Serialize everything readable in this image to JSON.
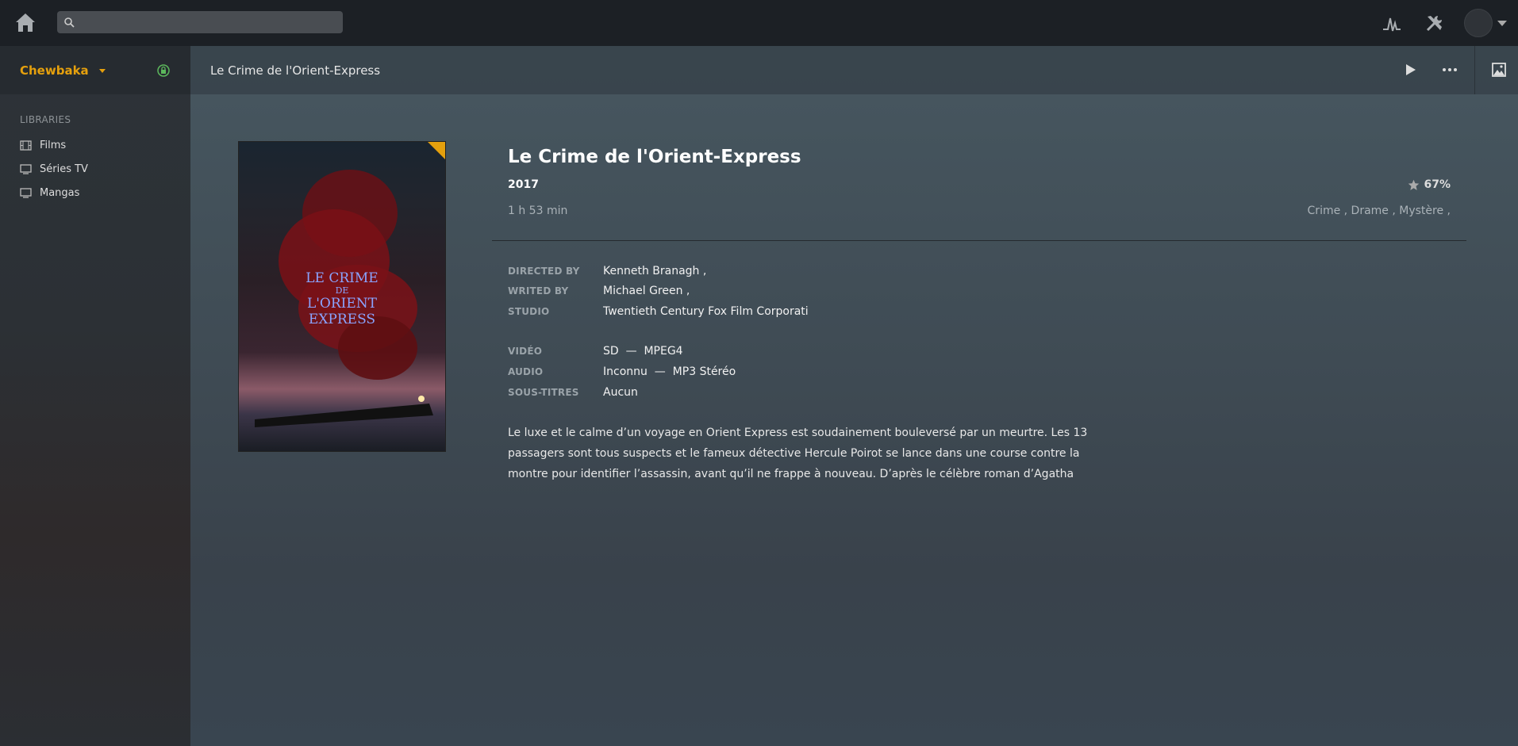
{
  "topbar": {
    "search_placeholder": ""
  },
  "sidebar": {
    "user": "Chewbaka",
    "libraries_title": "LIBRARIES",
    "items": [
      {
        "label": "Films",
        "icon": "film-icon"
      },
      {
        "label": "Séries TV",
        "icon": "tv-icon"
      },
      {
        "label": "Mangas",
        "icon": "tv-icon"
      }
    ]
  },
  "header": {
    "breadcrumb": "Le Crime de l'Orient-Express"
  },
  "movie": {
    "title": "Le Crime de l'Orient-Express",
    "year": "2017",
    "duration": "1 h 53 min",
    "rating": "67%",
    "genres": "Crime , Drame , Mystère ,",
    "poster_text": [
      "LE CRIME",
      "DE",
      "L'ORIENT",
      "EXPRESS"
    ],
    "details": [
      {
        "label": "DIRECTED BY",
        "value": "Kenneth Branagh ,"
      },
      {
        "label": "WRITED BY",
        "value": "Michael Green ,"
      },
      {
        "label": "STUDIO",
        "value": "Twentieth Century Fox Film Corporati"
      }
    ],
    "media": [
      {
        "label": "VIDÉO",
        "value": "SD  —  MPEG4"
      },
      {
        "label": "AUDIO",
        "value": "Inconnu  —  MP3 Stéréo"
      },
      {
        "label": "SOUS-TITRES",
        "value": "Aucun"
      }
    ],
    "synopsis": "Le luxe et le calme d’un voyage en Orient Express est soudainement bouleversé par un meurtre. Les 13 passagers sont tous suspects et le fameux détective Hercule Poirot se lance dans une course contre la montre pour identifier l’assassin, avant qu’il ne frappe à nouveau. D’après le célèbre roman d’Agatha"
  },
  "colors": {
    "accent": "#e5a00d",
    "topbar": "#1c2025",
    "lock_green": "#5cb85c"
  }
}
